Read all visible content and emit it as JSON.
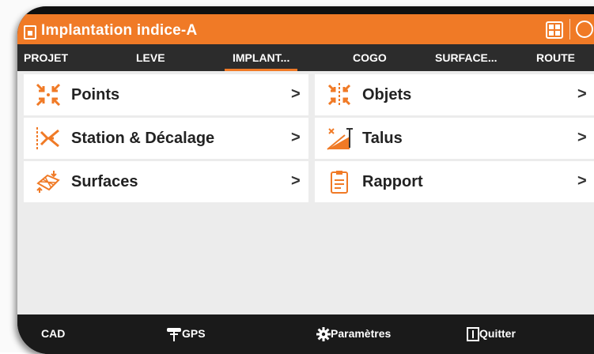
{
  "window": {
    "title": "Implantation indice-A"
  },
  "tabs": [
    {
      "label": "PROJET"
    },
    {
      "label": "LEVE"
    },
    {
      "label": "IMPLANT..."
    },
    {
      "label": "COGO"
    },
    {
      "label": "SURFACE..."
    },
    {
      "label": "ROUTE"
    }
  ],
  "active_tab": "IMPLANT...",
  "menu": {
    "left": [
      {
        "label": "Points",
        "icon": "points-icon"
      },
      {
        "label": "Station & Décalage",
        "icon": "station-offset-icon"
      },
      {
        "label": "Surfaces",
        "icon": "surfaces-icon"
      }
    ],
    "right": [
      {
        "label": "Objets",
        "icon": "objects-icon"
      },
      {
        "label": "Talus",
        "icon": "slope-icon"
      },
      {
        "label": "Rapport",
        "icon": "report-icon"
      }
    ],
    "chevron": ">"
  },
  "bottom": {
    "cad": "CAD",
    "gps": "GPS",
    "settings": "Paramètres",
    "quit": "Quitter"
  },
  "colors": {
    "accent": "#f07a26",
    "dark": "#2c2c2c",
    "bar": "#1a1a1a"
  }
}
